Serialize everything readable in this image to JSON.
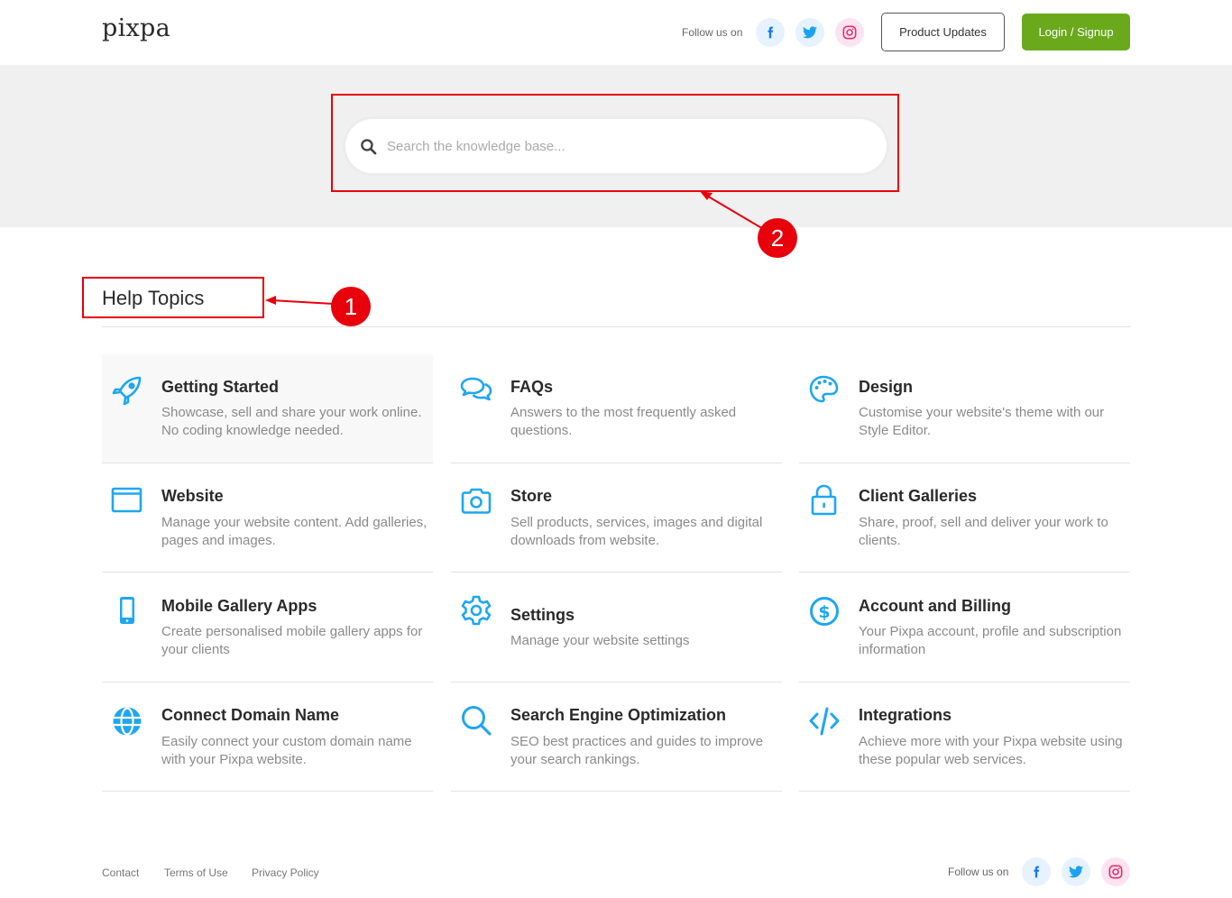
{
  "header": {
    "logo": "pixpa",
    "follow_label": "Follow us on",
    "social": [
      {
        "name": "facebook",
        "icon": "facebook-icon",
        "color": "#1877f2"
      },
      {
        "name": "twitter",
        "icon": "twitter-icon",
        "color": "#1da1f2"
      },
      {
        "name": "instagram",
        "icon": "instagram-icon",
        "color": "#e1306c"
      }
    ],
    "product_updates_label": "Product Updates",
    "login_label": "Login / Signup",
    "login_color": "#6aa91c"
  },
  "search": {
    "placeholder": "Search the knowledge base...",
    "value": "",
    "icon": "search-icon"
  },
  "annotations": [
    {
      "number": "1",
      "target": "help-topics-title"
    },
    {
      "number": "2",
      "target": "search-bar"
    }
  ],
  "help_topics": {
    "title": "Help Topics",
    "icon_color": "#1ea7f0",
    "items": [
      {
        "title": "Getting Started",
        "desc": "Showcase, sell and share your work online. No coding knowledge needed.",
        "icon": "rocket-icon"
      },
      {
        "title": "FAQs",
        "desc": "Answers to the most frequently asked questions.",
        "icon": "chat-bubbles-icon"
      },
      {
        "title": "Design",
        "desc": "Customise your website's theme with our Style Editor.",
        "icon": "palette-icon"
      },
      {
        "title": "Website",
        "desc": "Manage your website content. Add galleries, pages and images.",
        "icon": "browser-window-icon"
      },
      {
        "title": "Store",
        "desc": "Sell products, services, images and digital downloads from website.",
        "icon": "camera-icon"
      },
      {
        "title": "Client Galleries",
        "desc": "Share, proof, sell and deliver your work to clients.",
        "icon": "lock-icon"
      },
      {
        "title": "Mobile Gallery Apps",
        "desc": "Create personalised mobile gallery apps for your clients",
        "icon": "mobile-phone-icon"
      },
      {
        "title": "Settings",
        "desc": "Manage your website settings",
        "icon": "gear-icon"
      },
      {
        "title": "Account and Billing",
        "desc": "Your Pixpa account, profile and subscription information",
        "icon": "dollar-circle-icon"
      },
      {
        "title": "Connect Domain Name",
        "desc": "Easily connect your custom domain name with your Pixpa website.",
        "icon": "globe-icon"
      },
      {
        "title": "Search Engine Optimization",
        "desc": "SEO best practices and guides to improve your search rankings.",
        "icon": "magnifier-icon"
      },
      {
        "title": "Integrations",
        "desc": "Achieve more with your Pixpa website using these popular web services.",
        "icon": "code-icon"
      }
    ]
  },
  "footer": {
    "links": [
      "Contact",
      "Terms of Use",
      "Privacy Policy"
    ],
    "follow_label": "Follow us on"
  }
}
